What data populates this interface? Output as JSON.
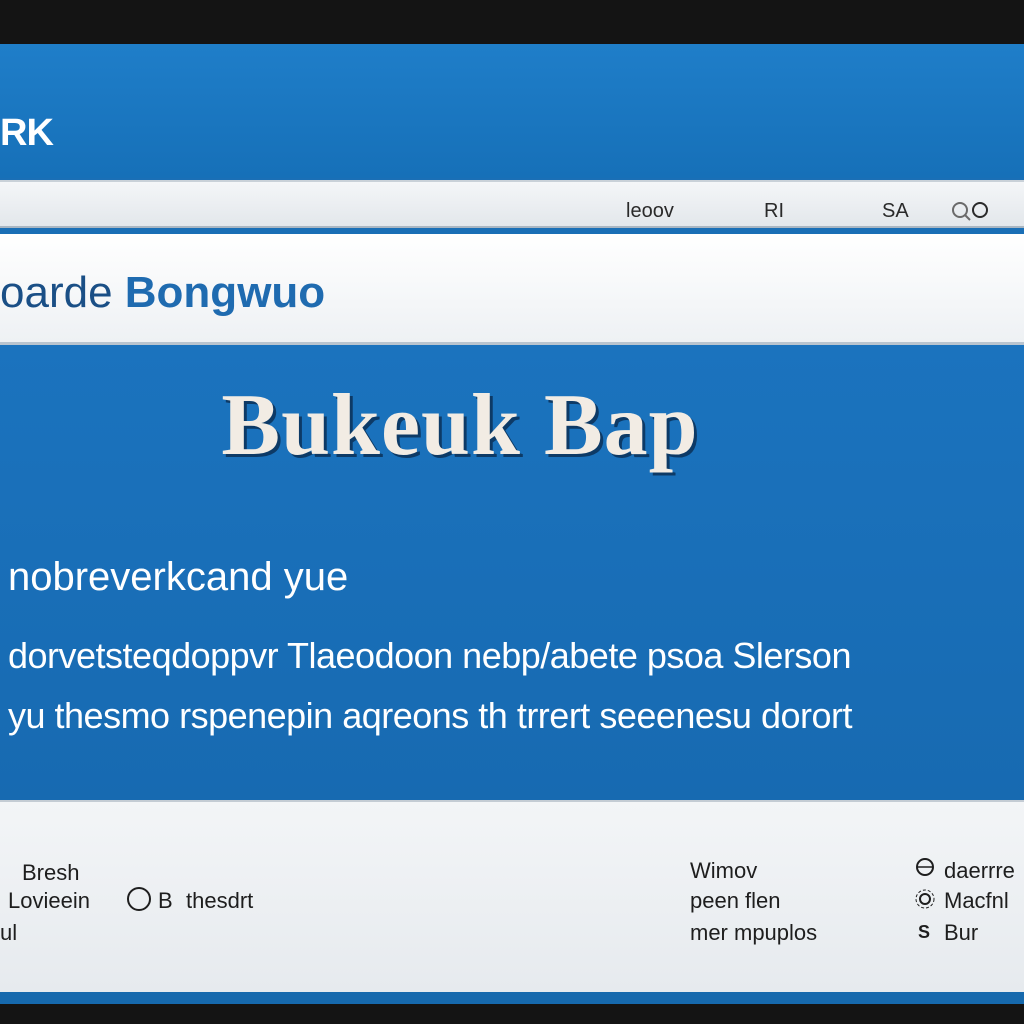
{
  "header": {
    "logo": "RK",
    "nav": [
      "leoov",
      "RI",
      "SA"
    ]
  },
  "title": {
    "prefix": "oarde",
    "main": "Bongwuo"
  },
  "hero": {
    "heading": "Bukeuk Bap",
    "subheading": "nobreverkcand  yue",
    "body_line1": "dorvetsteqdoppvr Tlaeodoon nebp/abete psoa Slerson",
    "body_line2": "yu thesmo rspenepin aqreons th trrert seeenesu dorort"
  },
  "footer": {
    "col1": {
      "line1": "Bresh",
      "line2": "Lovieein",
      "icon_text": "B",
      "link": "thesdrt",
      "line3": "ul"
    },
    "col2": [
      "Wimov",
      "peen flen",
      "mer mpuplos"
    ],
    "col3": [
      "daerrre",
      "Macfnl",
      "Bur"
    ]
  },
  "colors": {
    "brand_blue": "#1a6fb6",
    "header_blue": "#1f7ec9",
    "nav_grey": "#e3e7eb",
    "footer_bg": "#eef1f4",
    "title_blue": "#1f6bb0",
    "heading_cream": "#f2ece4"
  }
}
